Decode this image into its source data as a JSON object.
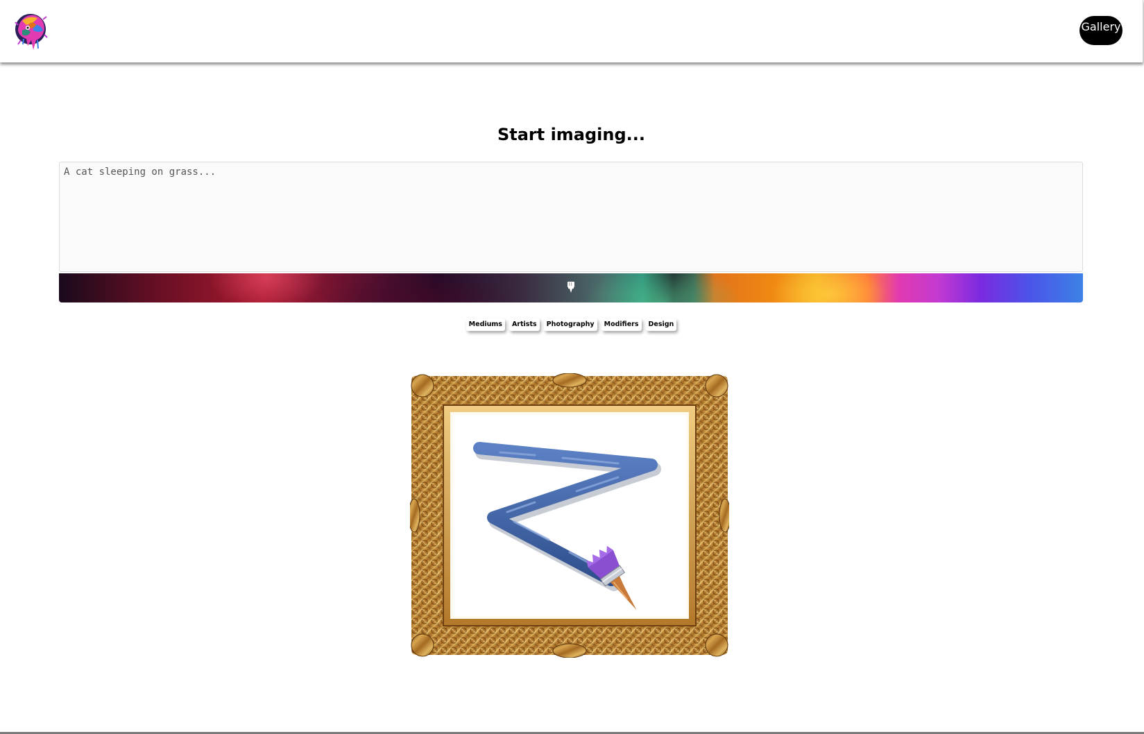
{
  "navbar": {
    "logo_icon": "splatter-face-logo-icon",
    "gallery_label": "Gallery"
  },
  "main": {
    "heading": "Start imaging...",
    "prompt": {
      "value": "",
      "placeholder": "A cat sleeping on grass..."
    },
    "generate_icon": "paintbrush-icon",
    "tags": [
      "Mediums",
      "Artists",
      "Photography",
      "Modifiers",
      "Design"
    ],
    "placeholder_image": "gold-frame-paintbrush-illustration"
  },
  "colors": {
    "gallery_button_bg": "#000000",
    "gallery_button_text": "#ffffff",
    "frame_gold": "#b8822e",
    "brush_stroke": "#3e63a6",
    "brush_bristles": "#8a4fd0"
  }
}
